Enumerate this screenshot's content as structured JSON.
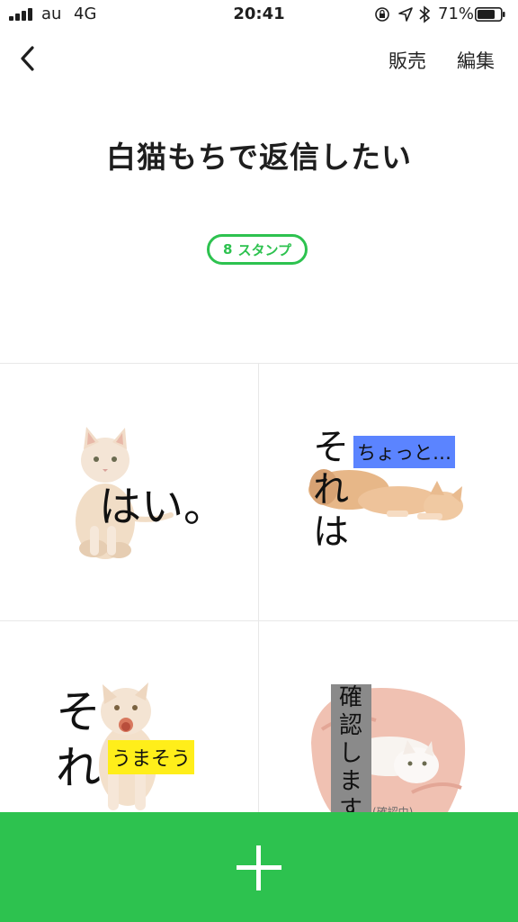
{
  "status_bar": {
    "carrier": "au",
    "network": "4G",
    "time": "20:41",
    "battery_percent": "71%",
    "icons": [
      "signal-icon",
      "lock-rotation-icon",
      "location-icon",
      "bluetooth-icon",
      "battery-icon"
    ]
  },
  "nav": {
    "back_icon": "chevron-left-icon",
    "sell_label": "販売",
    "edit_label": "編集"
  },
  "sticker_set": {
    "title": "白猫もちで返信したい",
    "count_number": "8",
    "count_label": "スタンプ",
    "accent_color": "#2dc24f"
  },
  "stamps": [
    {
      "text": "はい。"
    },
    {
      "text": "それは",
      "label": "ちょっと…",
      "label_color": "#5b84ff"
    },
    {
      "text": "それ",
      "label": "うまそう",
      "label_color": "#ffee1a"
    },
    {
      "label": "確認します",
      "label_color": "#8a8a8a",
      "caption": "(確認中)"
    }
  ],
  "add_button": {
    "icon": "plus-icon",
    "color": "#2dc24f"
  }
}
